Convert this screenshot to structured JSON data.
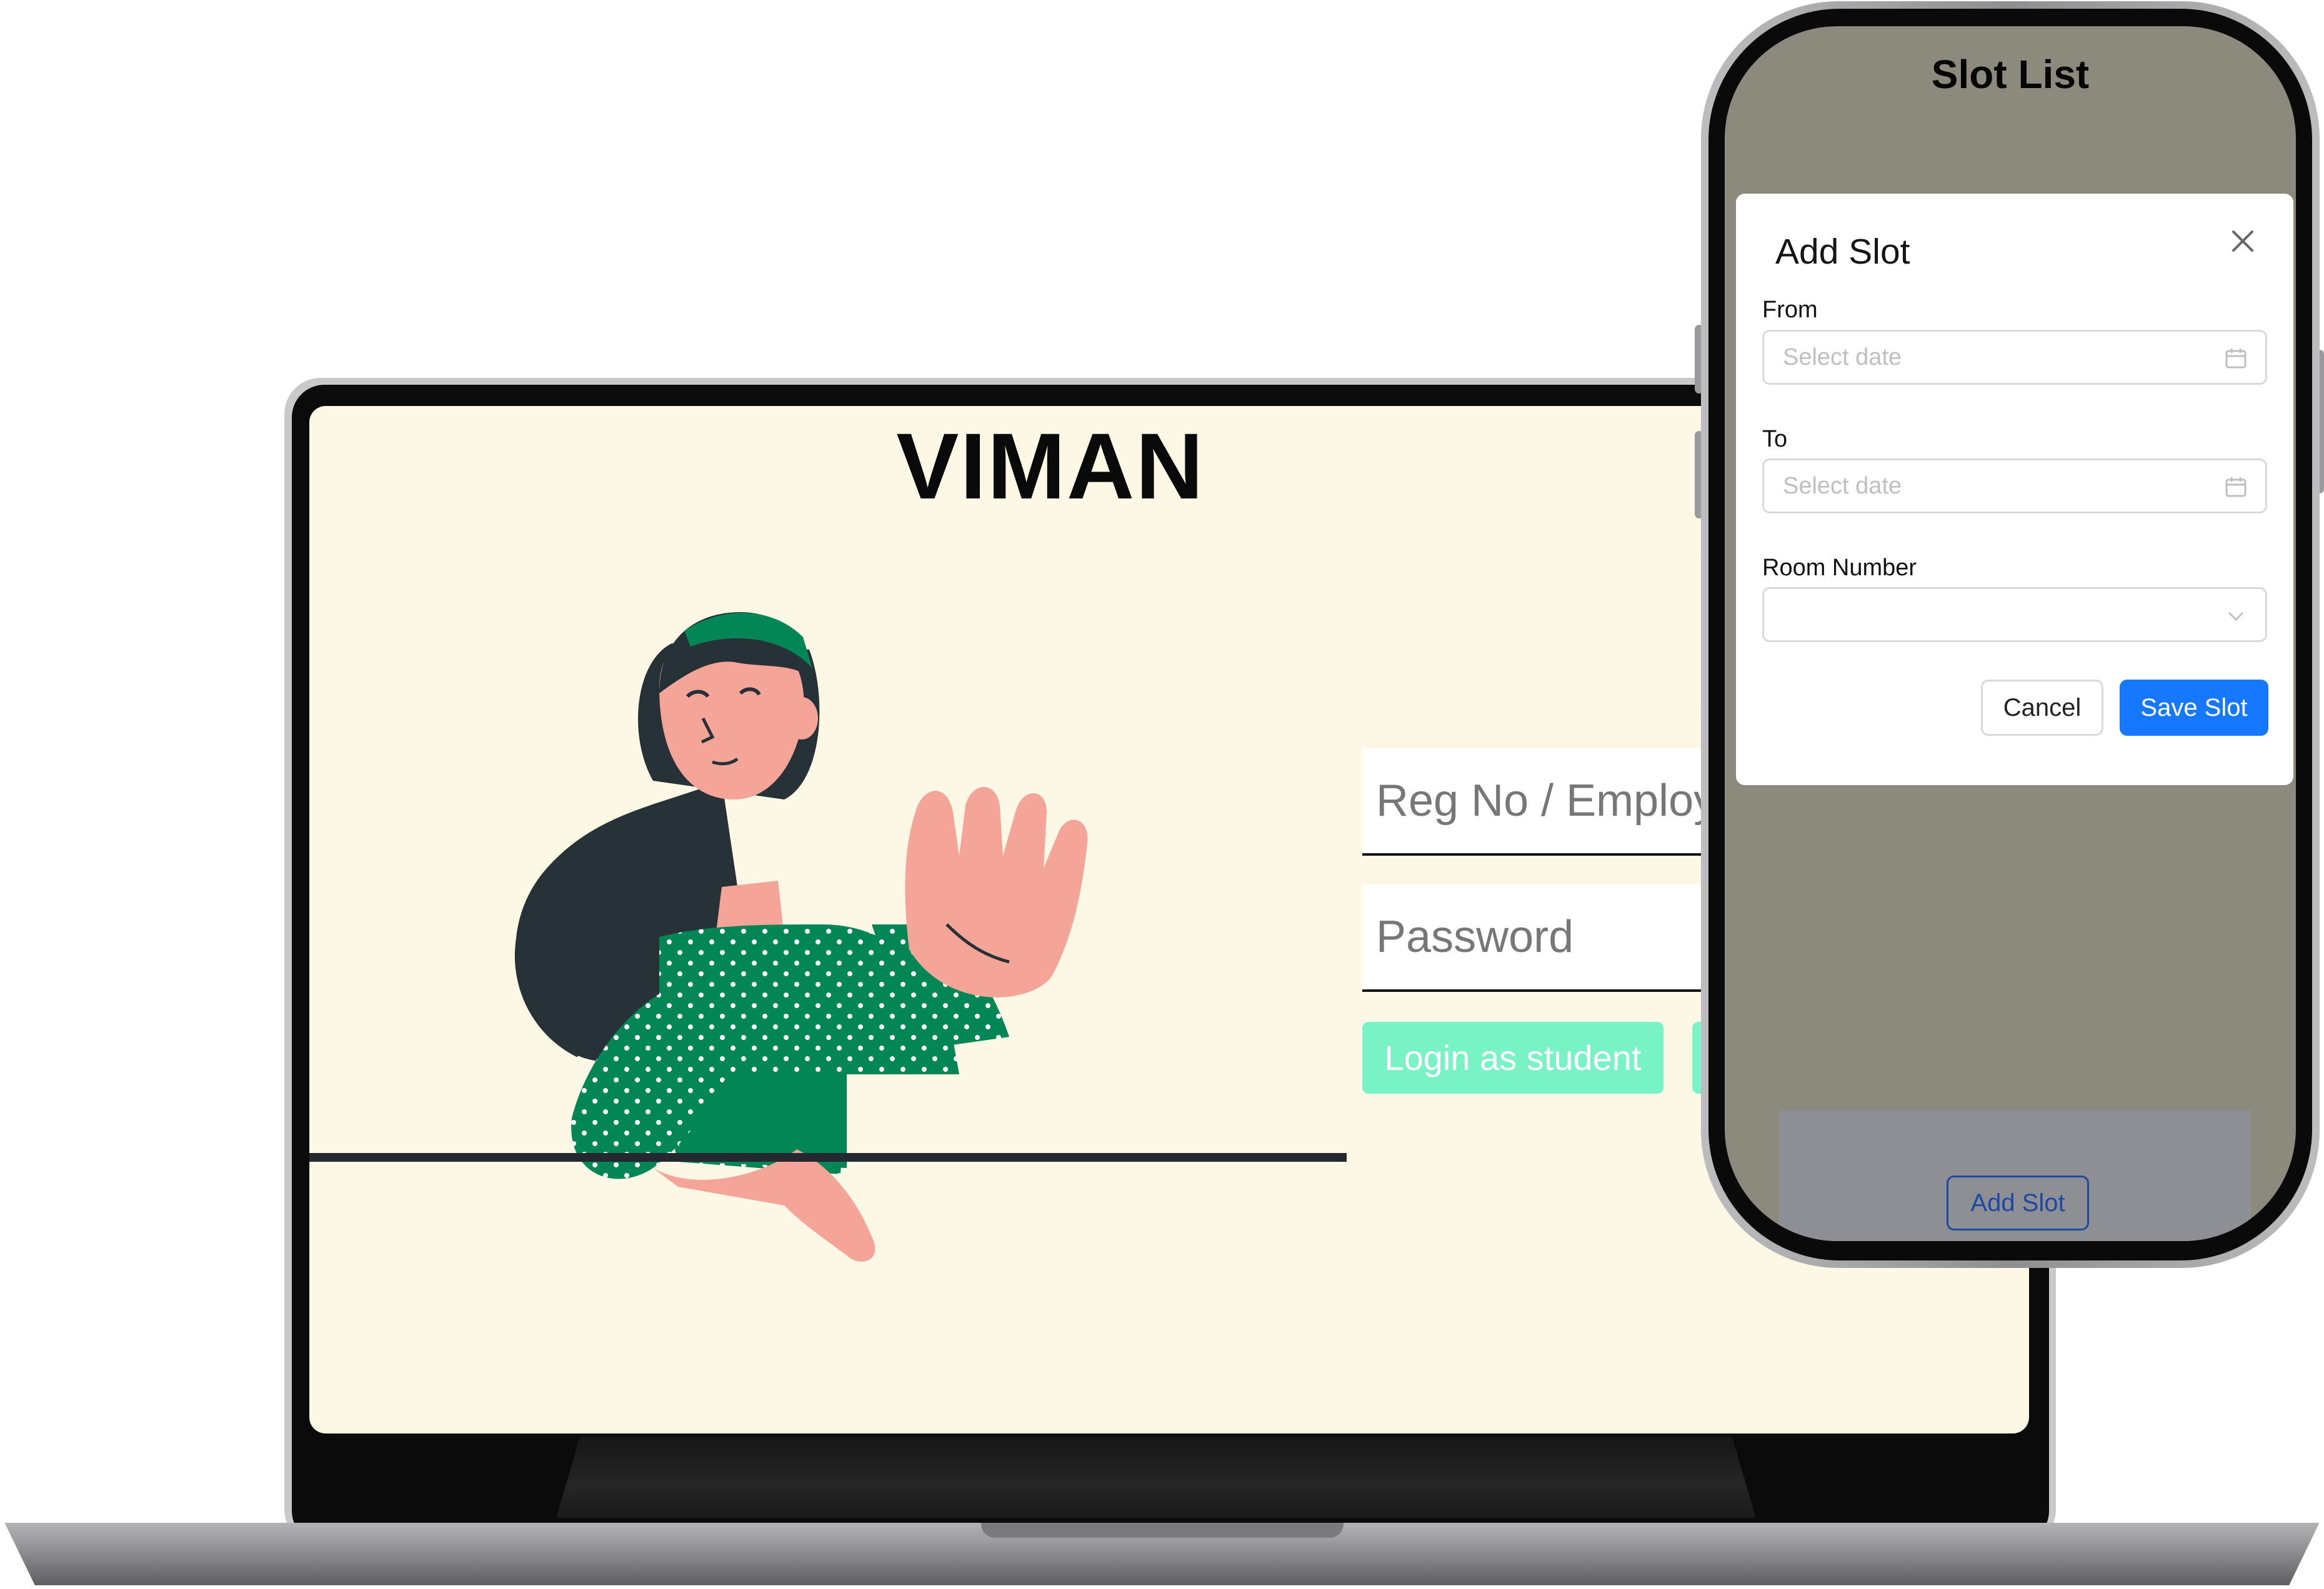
{
  "laptop": {
    "app_title": "VIMAN",
    "login": {
      "username_placeholder": "Reg No / Employ",
      "password_placeholder": "Password",
      "student_login_label": "Login as student",
      "second_login_label": ""
    },
    "colors": {
      "background": "#fdf8e5",
      "login_button": "#79f3c6",
      "illustration_shirt": "#038656",
      "illustration_skin": "#f4a597",
      "illustration_hair": "#263238"
    }
  },
  "phone": {
    "page_title": "Slot List",
    "add_slot_button_label": "Add Slot",
    "modal": {
      "title": "Add Slot",
      "close_icon": "close-icon",
      "from_label": "From",
      "from_placeholder": "Select date",
      "to_label": "To",
      "to_placeholder": "Select date",
      "room_label": "Room Number",
      "room_value": "",
      "cancel_label": "Cancel",
      "save_label": "Save Slot"
    },
    "colors": {
      "overlay": "#8c8a7d",
      "primary_button": "#1677ff"
    }
  }
}
